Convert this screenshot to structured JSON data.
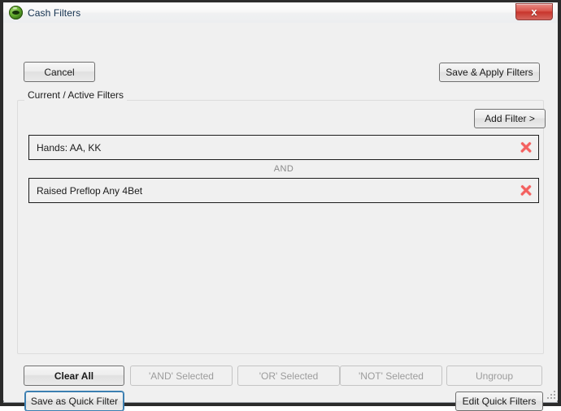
{
  "window": {
    "title": "Cash Filters",
    "icon": "poker-chip-icon",
    "close_label": "x",
    "accent_blue": "#3c7fb1",
    "delete_red": "#f4605f",
    "close_red": "#c8352c"
  },
  "toolbar": {
    "cancel_label": "Cancel",
    "save_apply_label": "Save & Apply Filters"
  },
  "group": {
    "title": "Current / Active Filters",
    "add_filter_label": "Add Filter >"
  },
  "filters": [
    {
      "label": "Hands: AA, KK",
      "delete_icon": "delete-x-icon"
    },
    {
      "label": "Raised Preflop Any 4Bet",
      "delete_icon": "delete-x-icon"
    }
  ],
  "connectors": [
    {
      "label": "AND"
    }
  ],
  "actions": [
    {
      "label": "Clear All",
      "enabled": true
    },
    {
      "label": "'AND' Selected",
      "enabled": false
    },
    {
      "label": "'OR' Selected",
      "enabled": false
    },
    {
      "label": "'NOT' Selected",
      "enabled": false
    },
    {
      "label": "Ungroup",
      "enabled": false
    }
  ],
  "footer": {
    "save_quick_filter_label": "Save as Quick Filter",
    "edit_quick_filters_label": "Edit Quick Filters"
  }
}
